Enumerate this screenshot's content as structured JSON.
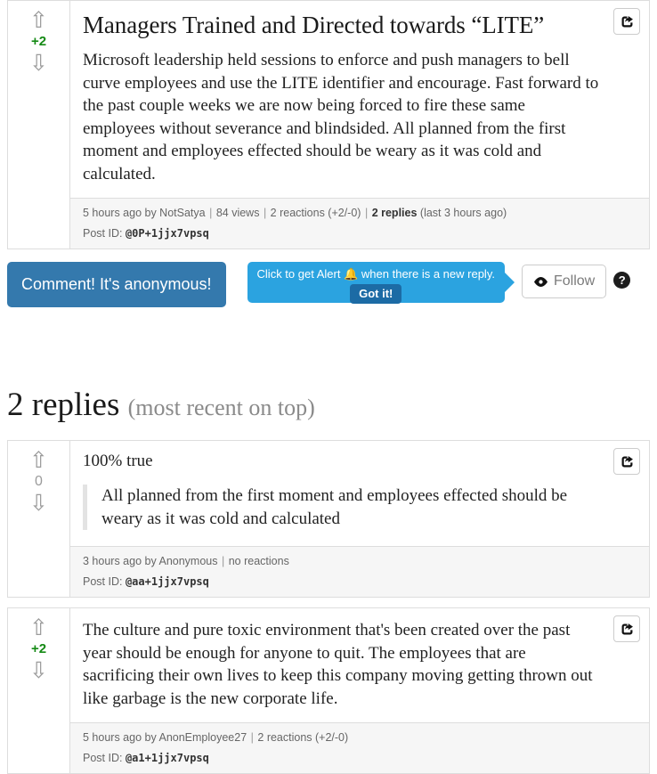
{
  "main_post": {
    "score": "+2",
    "upvote_icon": "arrow-up-outline",
    "downvote_icon": "arrow-down-outline",
    "share_icon": "share-square-icon",
    "title": "Managers Trained and Directed towards “LITE”",
    "body": "Microsoft leadership held sessions to enforce and push managers to bell curve employees and use the LITE identifier and encourage. Fast forward to the past couple weeks we are now being forced to fire these same employees without severance and blindsided. All planned from the first moment and employees effected should be weary as it was cold and calculated.",
    "footer": {
      "time_author": "5 hours ago by NotSatya",
      "views": "84 views",
      "reactions": "2 reactions (+2/-0)",
      "replies_count": "2 replies",
      "replies_last": "(last 3 hours ago)",
      "postid_label": "Post ID:",
      "postid_value": "@0P+1jjx7vpsq"
    }
  },
  "actions": {
    "comment_label": "Comment! It's anonymous!",
    "alert_text_before": "Click to get Alert",
    "alert_bell_icon": "bell-icon",
    "alert_text_after": "when there is a new reply.",
    "gotit_label": "Got it!",
    "follow_label": "Follow",
    "follow_icon": "eye-icon",
    "help_label": "?"
  },
  "replies_section": {
    "heading": "2 replies",
    "subheading": "(most recent on top)"
  },
  "replies": [
    {
      "score": "0",
      "score_state": "zero",
      "lead": "100% true",
      "quote": "All planned from the first moment and employees effected should be weary as it was cold and calculated",
      "body": "",
      "footer": {
        "time_author": "3 hours ago by Anonymous",
        "reactions": "no reactions",
        "postid_label": "Post ID:",
        "postid_value": "@aa+1jjx7vpsq"
      }
    },
    {
      "score": "+2",
      "score_state": "pos",
      "lead": "",
      "quote": "",
      "body": "The culture and pure toxic environment that's been created over the past year should be enough for anyone to quit. The employees that are sacrificing their own lives to keep this company moving getting thrown out like garbage is the new corporate life.",
      "footer": {
        "time_author": "5 hours ago by AnonEmployee27",
        "reactions": "2 reactions (+2/-0)",
        "postid_label": "Post ID:",
        "postid_value": "@a1+1jjx7vpsq"
      }
    }
  ],
  "colors": {
    "comment_button": "#3479ad",
    "tooltip": "#2ba3e0",
    "gotit_button": "#1c6ba5",
    "score_positive": "#158a15",
    "footer_bg": "#f6f6f6",
    "border": "#dddddd"
  }
}
